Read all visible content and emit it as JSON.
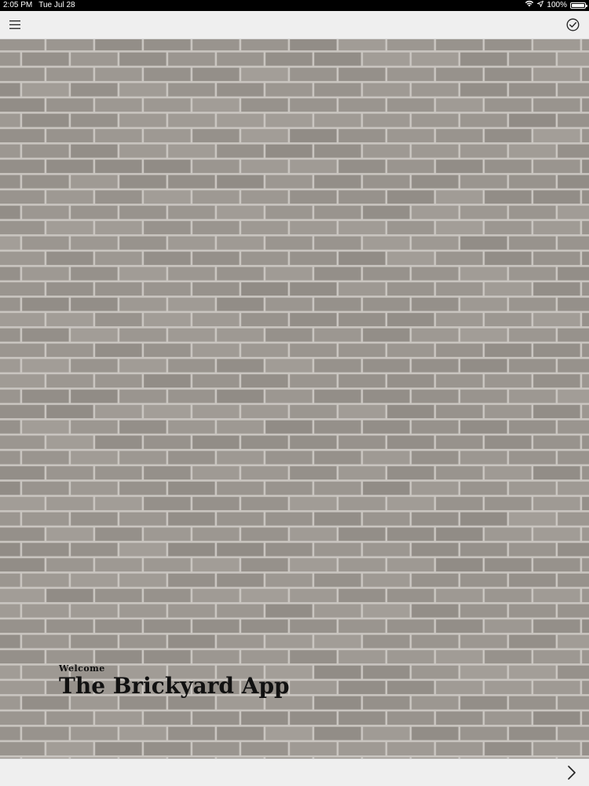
{
  "status_bar": {
    "time": "2:05 PM",
    "date": "Tue Jul 28",
    "battery_percent": "100%",
    "battery_level": 1.0,
    "icons": [
      "wifi-icon",
      "location-arrow-icon",
      "battery-icon"
    ]
  },
  "top_bar": {
    "menu_icon": "hamburger-menu-icon",
    "done_icon": "checkmark-circle-icon"
  },
  "hero": {
    "kicker": "Welcome",
    "title": "The Brickyard App",
    "background": "brick-wall-image"
  },
  "bottom_bar": {
    "next_icon": "chevron-right-icon"
  },
  "colors": {
    "bar_background": "#efefef",
    "brick": "#9a958f",
    "mortar": "#c9c5c0",
    "text": "#111111"
  }
}
